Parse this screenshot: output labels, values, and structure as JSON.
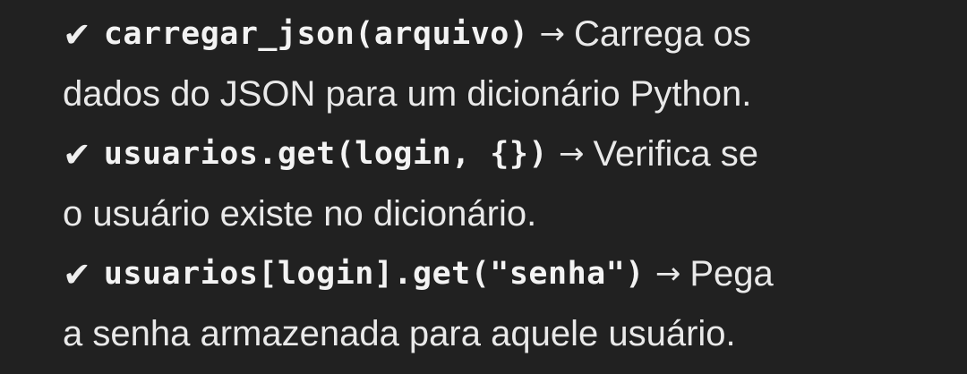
{
  "colors": {
    "background": "#212121",
    "text": "#e9e9e9"
  },
  "items": [
    {
      "icon": "checkmark-icon",
      "check": "✔",
      "code": "carregar_json(arquivo)",
      "arrow": "→",
      "desc_line1": "Carrega os",
      "desc_line2": "dados do JSON para um dicionário Python."
    },
    {
      "icon": "checkmark-icon",
      "check": "✔",
      "code": "usuarios.get(login, {})",
      "arrow": "→",
      "desc_line1": "Verifica se",
      "desc_line2": "o usuário existe no dicionário."
    },
    {
      "icon": "checkmark-icon",
      "check": "✔",
      "code": "usuarios[login].get(\"senha\")",
      "arrow": "→",
      "desc_line1": "Pega",
      "desc_line2": "a senha armazenada para aquele usuário."
    }
  ]
}
